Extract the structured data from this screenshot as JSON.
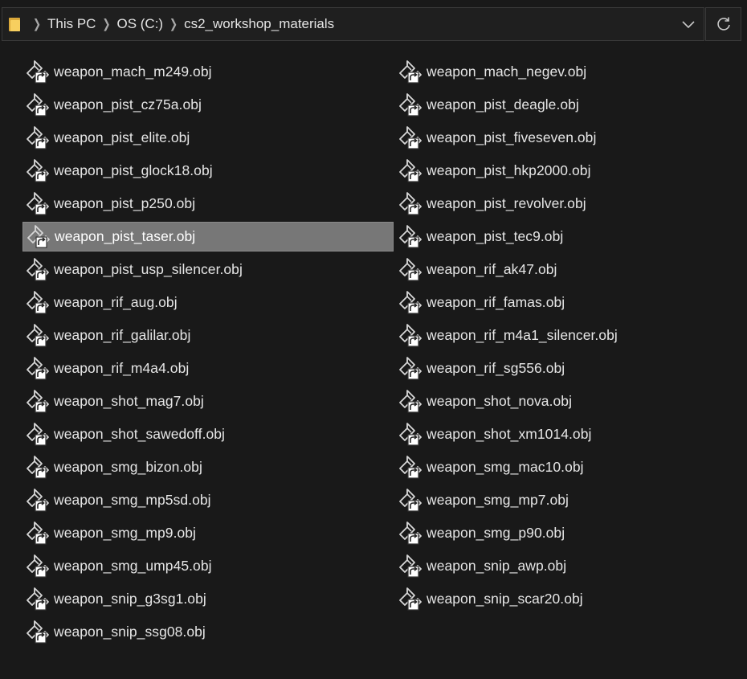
{
  "address_bar": {
    "breadcrumbs": [
      "This PC",
      "OS (C:)",
      "cs2_workshop_materials"
    ],
    "folder_icon": "folder-icon",
    "dropdown_icon": "chevron-down-icon",
    "refresh_icon": "refresh-icon"
  },
  "files": {
    "column_left": [
      {
        "name": "weapon_mach_m249.obj",
        "selected": false
      },
      {
        "name": "weapon_pist_cz75a.obj",
        "selected": false
      },
      {
        "name": "weapon_pist_elite.obj",
        "selected": false
      },
      {
        "name": "weapon_pist_glock18.obj",
        "selected": false
      },
      {
        "name": "weapon_pist_p250.obj",
        "selected": false
      },
      {
        "name": "weapon_pist_taser.obj",
        "selected": true
      },
      {
        "name": "weapon_pist_usp_silencer.obj",
        "selected": false
      },
      {
        "name": "weapon_rif_aug.obj",
        "selected": false
      },
      {
        "name": "weapon_rif_galilar.obj",
        "selected": false
      },
      {
        "name": "weapon_rif_m4a4.obj",
        "selected": false
      },
      {
        "name": "weapon_shot_mag7.obj",
        "selected": false
      },
      {
        "name": "weapon_shot_sawedoff.obj",
        "selected": false
      },
      {
        "name": "weapon_smg_bizon.obj",
        "selected": false
      },
      {
        "name": "weapon_smg_mp5sd.obj",
        "selected": false
      },
      {
        "name": "weapon_smg_mp9.obj",
        "selected": false
      },
      {
        "name": "weapon_smg_ump45.obj",
        "selected": false
      },
      {
        "name": "weapon_snip_g3sg1.obj",
        "selected": false
      },
      {
        "name": "weapon_snip_ssg08.obj",
        "selected": false
      }
    ],
    "column_right": [
      {
        "name": "weapon_mach_negev.obj",
        "selected": false
      },
      {
        "name": "weapon_pist_deagle.obj",
        "selected": false
      },
      {
        "name": "weapon_pist_fiveseven.obj",
        "selected": false
      },
      {
        "name": "weapon_pist_hkp2000.obj",
        "selected": false
      },
      {
        "name": "weapon_pist_revolver.obj",
        "selected": false
      },
      {
        "name": "weapon_pist_tec9.obj",
        "selected": false
      },
      {
        "name": "weapon_rif_ak47.obj",
        "selected": false
      },
      {
        "name": "weapon_rif_famas.obj",
        "selected": false
      },
      {
        "name": "weapon_rif_m4a1_silencer.obj",
        "selected": false
      },
      {
        "name": "weapon_rif_sg556.obj",
        "selected": false
      },
      {
        "name": "weapon_shot_nova.obj",
        "selected": false
      },
      {
        "name": "weapon_shot_xm1014.obj",
        "selected": false
      },
      {
        "name": "weapon_smg_mac10.obj",
        "selected": false
      },
      {
        "name": "weapon_smg_mp7.obj",
        "selected": false
      },
      {
        "name": "weapon_smg_p90.obj",
        "selected": false
      },
      {
        "name": "weapon_snip_awp.obj",
        "selected": false
      },
      {
        "name": "weapon_snip_scar20.obj",
        "selected": false
      }
    ],
    "file_icon": "obj-file-shortcut-icon"
  },
  "colors": {
    "background": "#191919",
    "selection": "#777777",
    "text": "#e6e6e6"
  }
}
